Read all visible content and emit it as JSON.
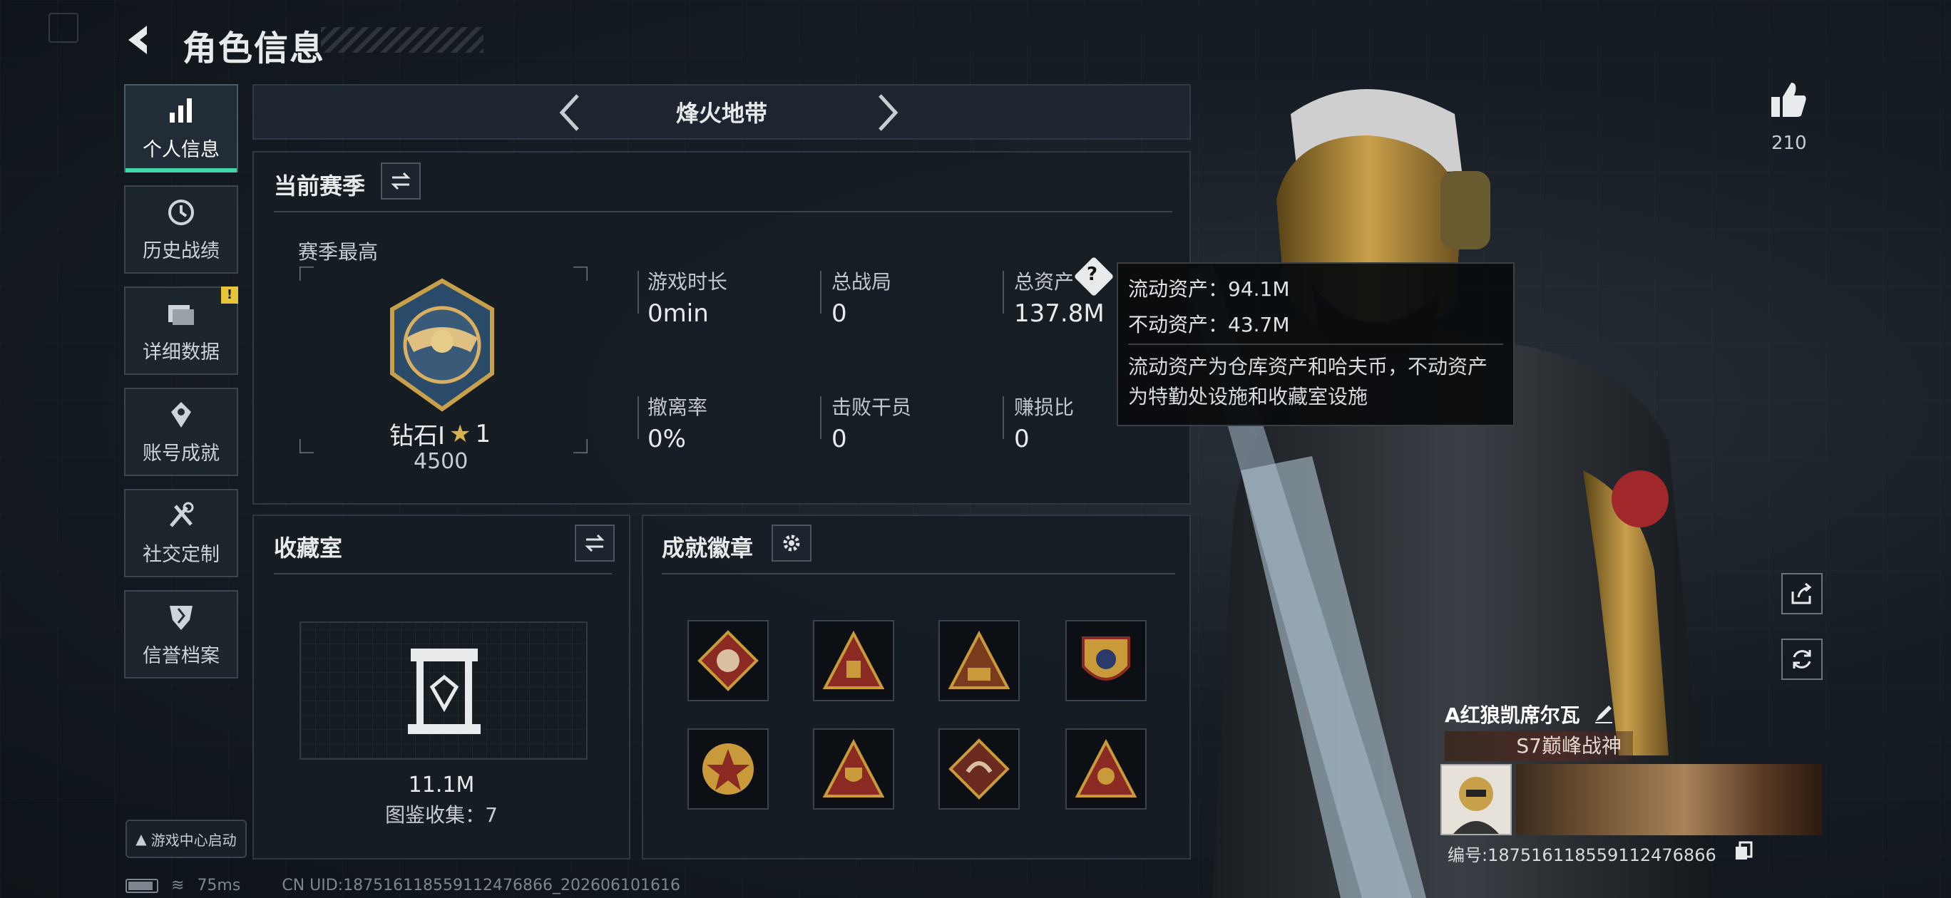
{
  "header": {
    "title": "角色信息"
  },
  "sidebar": {
    "items": [
      {
        "label": "个人信息",
        "icon": "bar-chart-icon",
        "active": true
      },
      {
        "label": "历史战绩",
        "icon": "history-clock-icon"
      },
      {
        "label": "详细数据",
        "icon": "folder-icon",
        "badge": "!"
      },
      {
        "label": "账号成就",
        "icon": "achievement-icon"
      },
      {
        "label": "社交定制",
        "icon": "tools-icon"
      },
      {
        "label": "信誉档案",
        "icon": "shield-icon"
      }
    ],
    "game_center": "游戏中心启动"
  },
  "mode_selector": {
    "label": "烽火地带"
  },
  "season": {
    "title": "当前赛季",
    "highest_label": "赛季最高",
    "rank_name": "钻石Ⅰ",
    "rank_stars": "1",
    "rank_score": "4500",
    "stats": [
      {
        "label": "游戏时长",
        "value": "0min"
      },
      {
        "label": "总战局",
        "value": "0"
      },
      {
        "label": "总资产",
        "value": "137.8M"
      },
      {
        "label": "撤离率",
        "value": "0%"
      },
      {
        "label": "击败干员",
        "value": "0"
      },
      {
        "label": "赚损比",
        "value": "0"
      }
    ]
  },
  "tooltip": {
    "liquid": "流动资产：94.1M",
    "fixed": "不动资产：43.7M",
    "desc_line1": "流动资产为仓库资产和哈夫币，不动资产",
    "desc_line2": "为特勤处设施和收藏室设施"
  },
  "collection": {
    "title": "收藏室",
    "value": "11.1M",
    "catalog": "图鉴收集：7"
  },
  "badges": {
    "title": "成就徽章"
  },
  "likes": {
    "count": "210"
  },
  "player": {
    "name": "A红狼凯席尔瓦",
    "title_tag": "S7巅峰战神",
    "uid": "编号:1875161185591124768​66"
  },
  "status": {
    "ping": "75ms",
    "uid_full": "CN UID:1875161185591124768​66_202606101616"
  },
  "colors": {
    "accent": "#3fd8a8",
    "warn": "#e8c43a",
    "badge_red": "#8a2a22",
    "badge_gold": "#c89a3a"
  }
}
